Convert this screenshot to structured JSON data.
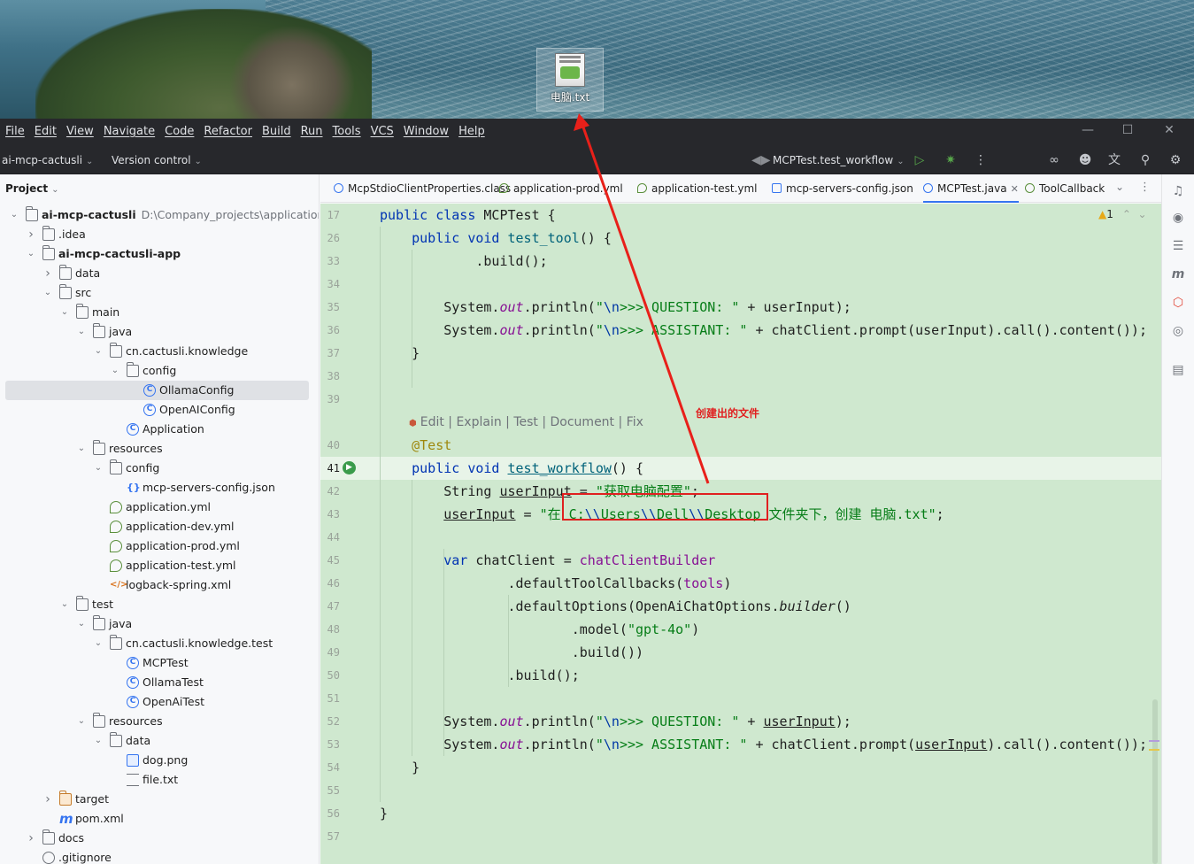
{
  "desktop": {
    "icon_label": "电脑.txt"
  },
  "menubar": {
    "items": [
      "File",
      "Edit",
      "View",
      "Navigate",
      "Code",
      "Refactor",
      "Build",
      "Run",
      "Tools",
      "VCS",
      "Window",
      "Help"
    ]
  },
  "toolbar": {
    "project_name": "ai-mcp-cactusli",
    "version_control": "Version control",
    "run_config": "MCPTest.test_workflow"
  },
  "project_panel": {
    "title": "Project",
    "tree": [
      {
        "label": "ai-mcp-cactusli",
        "path": "D:\\Company_projects\\application\\ai-m",
        "depth": 0,
        "arrow": "down",
        "icon": "module",
        "bold": true
      },
      {
        "label": ".idea",
        "depth": 1,
        "arrow": "right",
        "icon": "folder"
      },
      {
        "label": "ai-mcp-cactusli-app",
        "depth": 1,
        "arrow": "down",
        "icon": "module",
        "bold": true
      },
      {
        "label": "data",
        "depth": 2,
        "arrow": "right",
        "icon": "folder"
      },
      {
        "label": "src",
        "depth": 2,
        "arrow": "down",
        "icon": "folder"
      },
      {
        "label": "main",
        "depth": 3,
        "arrow": "down",
        "icon": "folder"
      },
      {
        "label": "java",
        "depth": 4,
        "arrow": "down",
        "icon": "folder"
      },
      {
        "label": "cn.cactusli.knowledge",
        "depth": 5,
        "arrow": "down",
        "icon": "package"
      },
      {
        "label": "config",
        "depth": 6,
        "arrow": "down",
        "icon": "package"
      },
      {
        "label": "OllamaConfig",
        "depth": 7,
        "arrow": "",
        "icon": "class",
        "selected": true
      },
      {
        "label": "OpenAIConfig",
        "depth": 7,
        "arrow": "",
        "icon": "class"
      },
      {
        "label": "Application",
        "depth": 6,
        "arrow": "",
        "icon": "class"
      },
      {
        "label": "resources",
        "depth": 4,
        "arrow": "down",
        "icon": "folder"
      },
      {
        "label": "config",
        "depth": 5,
        "arrow": "down",
        "icon": "folder"
      },
      {
        "label": "mcp-servers-config.json",
        "depth": 6,
        "arrow": "",
        "icon": "json"
      },
      {
        "label": "application.yml",
        "depth": 5,
        "arrow": "",
        "icon": "yml"
      },
      {
        "label": "application-dev.yml",
        "depth": 5,
        "arrow": "",
        "icon": "yml"
      },
      {
        "label": "application-prod.yml",
        "depth": 5,
        "arrow": "",
        "icon": "yml"
      },
      {
        "label": "application-test.yml",
        "depth": 5,
        "arrow": "",
        "icon": "yml"
      },
      {
        "label": "logback-spring.xml",
        "depth": 5,
        "arrow": "",
        "icon": "xml"
      },
      {
        "label": "test",
        "depth": 3,
        "arrow": "down",
        "icon": "folder"
      },
      {
        "label": "java",
        "depth": 4,
        "arrow": "down",
        "icon": "folder"
      },
      {
        "label": "cn.cactusli.knowledge.test",
        "depth": 5,
        "arrow": "down",
        "icon": "package"
      },
      {
        "label": "MCPTest",
        "depth": 6,
        "arrow": "",
        "icon": "class"
      },
      {
        "label": "OllamaTest",
        "depth": 6,
        "arrow": "",
        "icon": "class"
      },
      {
        "label": "OpenAiTest",
        "depth": 6,
        "arrow": "",
        "icon": "class"
      },
      {
        "label": "resources",
        "depth": 4,
        "arrow": "down",
        "icon": "folder"
      },
      {
        "label": "data",
        "depth": 5,
        "arrow": "down",
        "icon": "folder"
      },
      {
        "label": "dog.png",
        "depth": 6,
        "arrow": "",
        "icon": "png"
      },
      {
        "label": "file.txt",
        "depth": 6,
        "arrow": "",
        "icon": "txt"
      },
      {
        "label": "target",
        "depth": 2,
        "arrow": "right",
        "icon": "folder-orange"
      },
      {
        "label": "pom.xml",
        "depth": 2,
        "arrow": "",
        "icon": "maven"
      },
      {
        "label": "docs",
        "depth": 1,
        "arrow": "right",
        "icon": "folder"
      },
      {
        "label": ".gitignore",
        "depth": 1,
        "arrow": "",
        "icon": "ignore"
      }
    ]
  },
  "editor": {
    "tabs": [
      {
        "label": "McpStdioClientProperties.class",
        "icon": "class"
      },
      {
        "label": "application-prod.yml",
        "icon": "yml"
      },
      {
        "label": "application-test.yml",
        "icon": "yml"
      },
      {
        "label": "mcp-servers-config.json",
        "icon": "json"
      },
      {
        "label": "MCPTest.java",
        "icon": "class",
        "active": true
      },
      {
        "label": "ToolCallback",
        "icon": "interface"
      }
    ],
    "warning_count": "1",
    "inlay_hint": "Edit | Explain | Test | Document | Fix",
    "current_line": "41",
    "line_numbers": [
      "17",
      "26",
      "33",
      "34",
      "35",
      "36",
      "37",
      "38",
      "39",
      "",
      "40",
      "41",
      "42",
      "43",
      "44",
      "45",
      "46",
      "47",
      "48",
      "49",
      "50",
      "51",
      "52",
      "53",
      "54",
      "55",
      "56",
      "57"
    ]
  },
  "annotations": {
    "note": "创建出的文件",
    "highlighted_text": "C:\\\\Users\\\\Dell\\\\Desktop"
  }
}
